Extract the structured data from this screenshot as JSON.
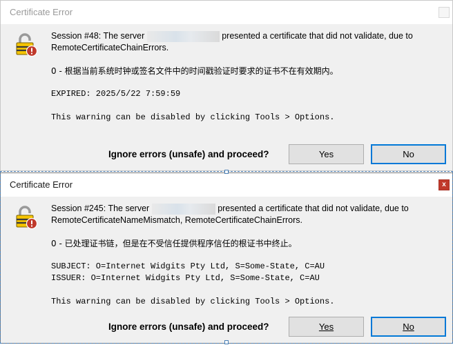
{
  "dialogs": [
    {
      "title": "Certificate Error",
      "session_prefix": "Session #48: The server",
      "session_suffix": "presented a certificate that did not validate, due to",
      "errors_line": "RemoteCertificateChainErrors.",
      "detail_zh": "0 - 根据当前系统时钟或签名文件中的时间戳验证时要求的证书不在有效期内。",
      "mono_lines": [
        "EXPIRED: 2025/5/22 7:59:59"
      ],
      "warning": "This warning can be disabled by clicking Tools > Options.",
      "prompt": "Ignore errors (unsafe) and proceed?",
      "yes_label": "Yes",
      "no_label": "No"
    },
    {
      "title": "Certificate Error",
      "close_glyph": "x",
      "session_prefix": "Session #245: The server",
      "session_suffix": "presented a certificate that did not validate, due to",
      "errors_line": "RemoteCertificateNameMismatch, RemoteCertificateChainErrors.",
      "detail_zh": "0 - 已处理证书链，但是在不受信任提供程序信任的根证书中终止。",
      "mono_lines": [
        "SUBJECT: O=Internet Widgits Pty Ltd, S=Some-State, C=AU",
        "ISSUER: O=Internet Widgits Pty Ltd, S=Some-State, C=AU"
      ],
      "warning": "This warning can be disabled by clicking Tools > Options.",
      "prompt": "Ignore errors (unsafe) and proceed?",
      "yes_label": "Yes",
      "no_label": "No"
    }
  ],
  "icons": {
    "dialog_icon": "padlock-warning-icon",
    "close": "close-icon"
  },
  "colors": {
    "accent": "#0078d7",
    "error_red": "#c0392b",
    "lock_yellow": "#f5c400"
  }
}
